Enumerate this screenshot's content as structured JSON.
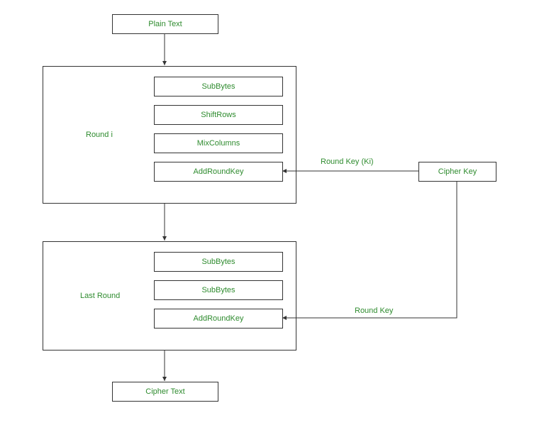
{
  "plaintext": "Plain Text",
  "roundi": {
    "label": "Round i",
    "steps": [
      "SubBytes",
      "ShiftRows",
      "MixColumns",
      "AddRoundKey"
    ]
  },
  "lastround": {
    "label": "Last Round",
    "steps": [
      "SubBytes",
      "SubBytes",
      "AddRoundKey"
    ]
  },
  "ciphertext": "Cipher Text",
  "cipherkey": "Cipher Key",
  "roundkey_i": "Round Key (Ki)",
  "roundkey_last": "Round Key"
}
